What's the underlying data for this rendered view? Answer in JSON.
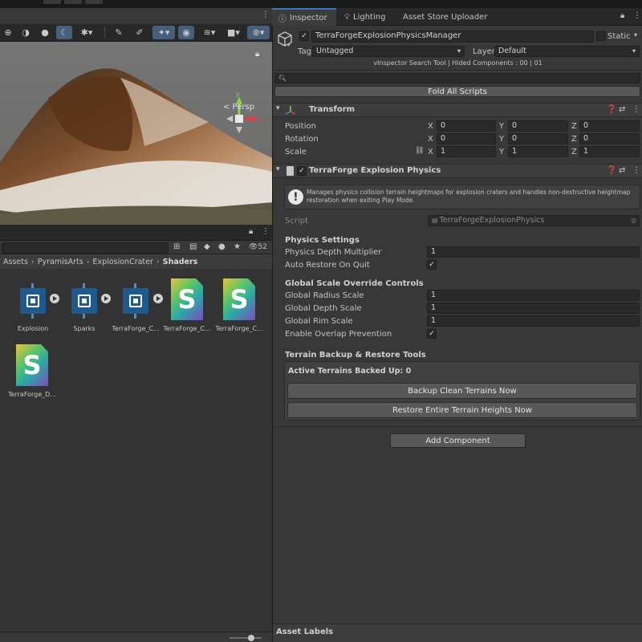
{
  "inspector": {
    "tabs": [
      {
        "label": "Inspector"
      },
      {
        "label": "Lighting"
      },
      {
        "label": "Asset Store Uploader"
      }
    ],
    "object": {
      "name": "TerraForgeExplosionPhysicsManager",
      "static_label": "Static",
      "tag_label": "Tag",
      "tag_value": "Untagged",
      "layer_label": "Layer",
      "layer_value": "Default"
    },
    "vinspector_info": "vInspector Search Tool | Hided Components : 00 | 01",
    "fold_all_label": "Fold All Scripts",
    "transform": {
      "title": "Transform",
      "position_label": "Position",
      "rotation_label": "Rotation",
      "scale_label": "Scale",
      "x": "X",
      "y": "Y",
      "z": "Z",
      "position": [
        "0",
        "0",
        "0"
      ],
      "rotation": [
        "0",
        "0",
        "0"
      ],
      "scale": [
        "1",
        "1",
        "1"
      ]
    },
    "component": {
      "title": "TerraForge Explosion Physics",
      "help_text": "Manages physics collision terrain heightmaps for explosion craters and handles non-destructive heightmap restoration when exiting Play Mode.",
      "script_label": "Script",
      "script_value": "TerraForgeExplosionPhysics",
      "physics_settings_title": "Physics Settings",
      "physics_depth_label": "Physics Depth Multiplier",
      "physics_depth_value": "1",
      "auto_restore_label": "Auto Restore On Quit",
      "global_scale_title": "Global Scale Override Controls",
      "radius_label": "Global Radius Scale",
      "radius_value": "1",
      "depth_label": "Global Depth Scale",
      "depth_value": "1",
      "rim_label": "Global Rim Scale",
      "rim_value": "1",
      "overlap_label": "Enable Overlap Prevention",
      "backup_title": "Terrain Backup & Restore Tools",
      "active_backed_up": "Active Terrains Backed Up: 0",
      "backup_button": "Backup Clean Terrains Now",
      "restore_button": "Restore Entire Terrain Heights Now"
    },
    "add_component_label": "Add Component",
    "asset_labels_title": "Asset Labels"
  },
  "scene": {
    "persp_label": "< Persp",
    "gizmo_axes": {
      "x": "x",
      "y": "y"
    }
  },
  "project": {
    "hidden_count": "52",
    "breadcrumb": [
      "Assets",
      "PyramisArts",
      "ExplosionCrater",
      "Shaders"
    ],
    "assets": [
      {
        "name": "Explosion",
        "kind": "vfx"
      },
      {
        "name": "Sparks",
        "kind": "vfx"
      },
      {
        "name": "TerraForge_C...",
        "kind": "vfx"
      },
      {
        "name": "TerraForge_C...",
        "kind": "shader"
      },
      {
        "name": "TerraForge_C...",
        "kind": "shader"
      },
      {
        "name": "TerraForge_D...",
        "kind": "shader"
      }
    ]
  },
  "colors": {
    "accent": "#3a79bb",
    "panel": "#383838",
    "vfx_blue": "#1f5a8e"
  }
}
